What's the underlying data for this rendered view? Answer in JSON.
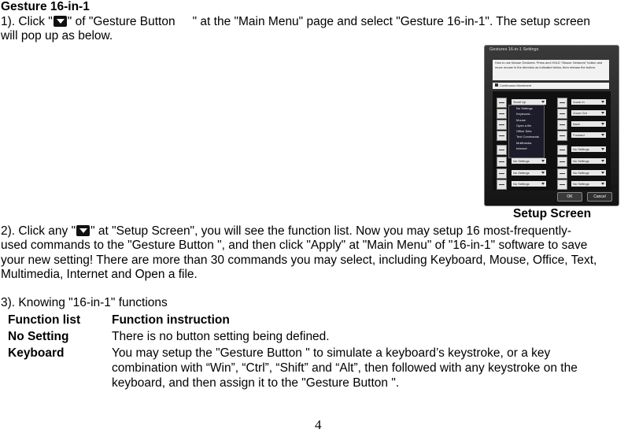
{
  "heading": "Gesture 16-in-1",
  "step1": {
    "line1_a": "1). Click \"",
    "line1_b": "\" of \"Gesture Button",
    "line1_c": "\" at the \"Main Menu\" page and select \"Gesture 16-in-1\".  The setup screen",
    "line2": "will pop up as below."
  },
  "screenshot": {
    "title": "Gestures 16-in-1 Settings",
    "help_text": "How to use Mouse Gestures: Press and HOLD \"Mouse Gestures\" button and move mouse in the direction as indicated below, then release the button.",
    "continuous_movement": "Continuous Movement",
    "left_options": [
      "Scroll Up",
      "",
      "",
      "",
      "",
      "No Settings",
      "No Settings",
      "No Settings"
    ],
    "right_options": [
      "Zoom In",
      "Zoom Out",
      "Back",
      "Forward",
      "No Settings",
      "No Settings",
      "No Settings",
      "No Settings"
    ],
    "menu_items": [
      "No Settings",
      "Keyboard...",
      "Mouse",
      "Open a file",
      "Office Sets",
      "Text Commands",
      "Multimedia",
      "Internet"
    ],
    "ok_label": "OK",
    "cancel_label": "Cancel",
    "caption": "Setup Screen"
  },
  "step2": {
    "line1_a": " 2). Click any \"",
    "line1_b": "\" at \"Setup Screen\", you will see the function list. Now you may setup 16 most-frequently-",
    "line2": "used commands to the \"Gesture Button    \", and then click \"Apply\" at \"Main Menu\" of \"16-in-1\" software to save",
    "line3": "your new setting! There are more than 30 commands you may select, including Keyboard, Mouse, Office, Text,",
    "line4": "Multimedia, Internet and Open a file."
  },
  "step3": {
    "intro": "3). Knowing \"16-in-1\" functions",
    "col1_header": "Function list",
    "col2_header": "Function instruction",
    "rows": [
      {
        "name": "No Setting",
        "desc": [
          "There is no button setting being defined."
        ]
      },
      {
        "name": "Keyboard",
        "desc": [
          "You may setup the \"Gesture Button   \" to simulate a keyboard’s keystroke, or a key",
          "combination with “Win”, “Ctrl”, “Shift” and “Alt”, then followed with any keystroke on the",
          "keyboard, and then assign it to the \"Gesture Button   \"."
        ]
      }
    ]
  },
  "page_number": "4"
}
